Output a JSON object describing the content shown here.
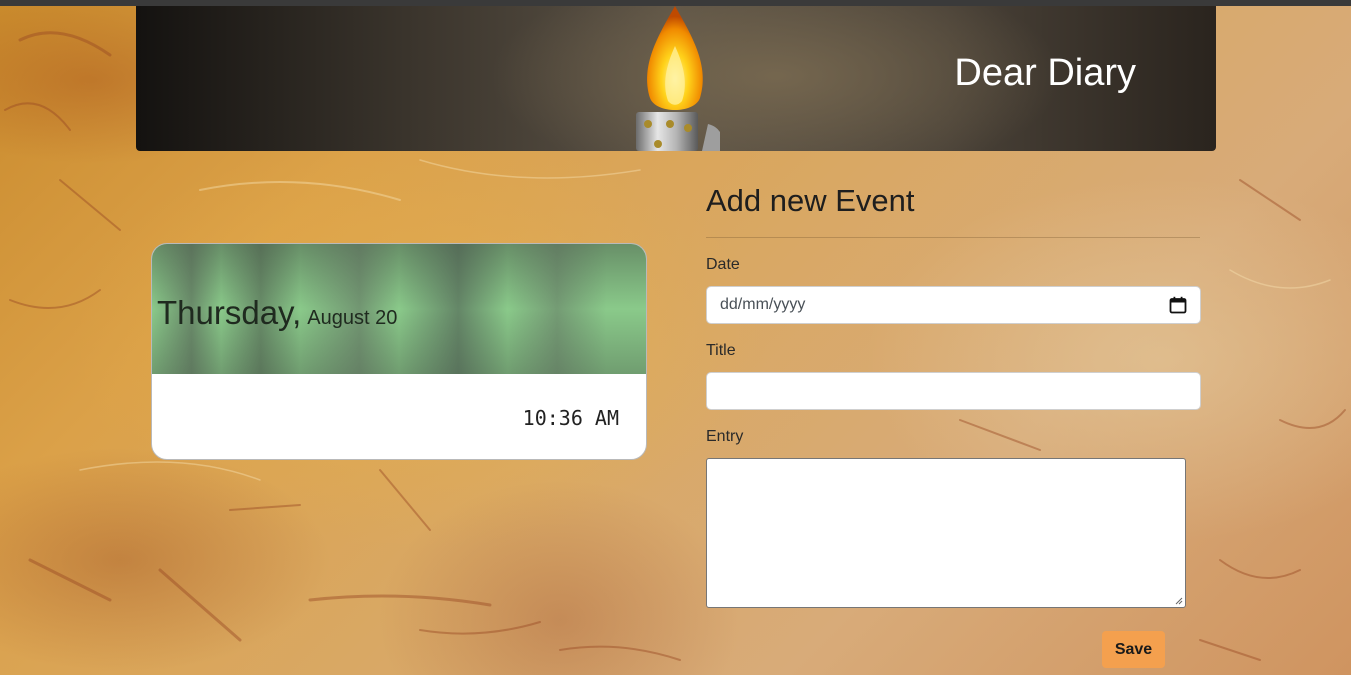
{
  "header": {
    "title": "Dear Diary",
    "decoration_icon": "lighter-flame-icon"
  },
  "clock": {
    "day": "Thursday,",
    "date": "August 20",
    "time": "10:36 AM"
  },
  "form": {
    "title": "Add new Event",
    "date_label": "Date",
    "date_placeholder": "dd/mm/yyyy",
    "date_icon": "calendar-icon",
    "title_label": "Title",
    "title_value": "",
    "entry_label": "Entry",
    "entry_value": "",
    "save_label": "Save"
  },
  "colors": {
    "save_button": "#f4a04e",
    "clock_header": "#8ccc8c",
    "banner_text": "#ffffff"
  }
}
